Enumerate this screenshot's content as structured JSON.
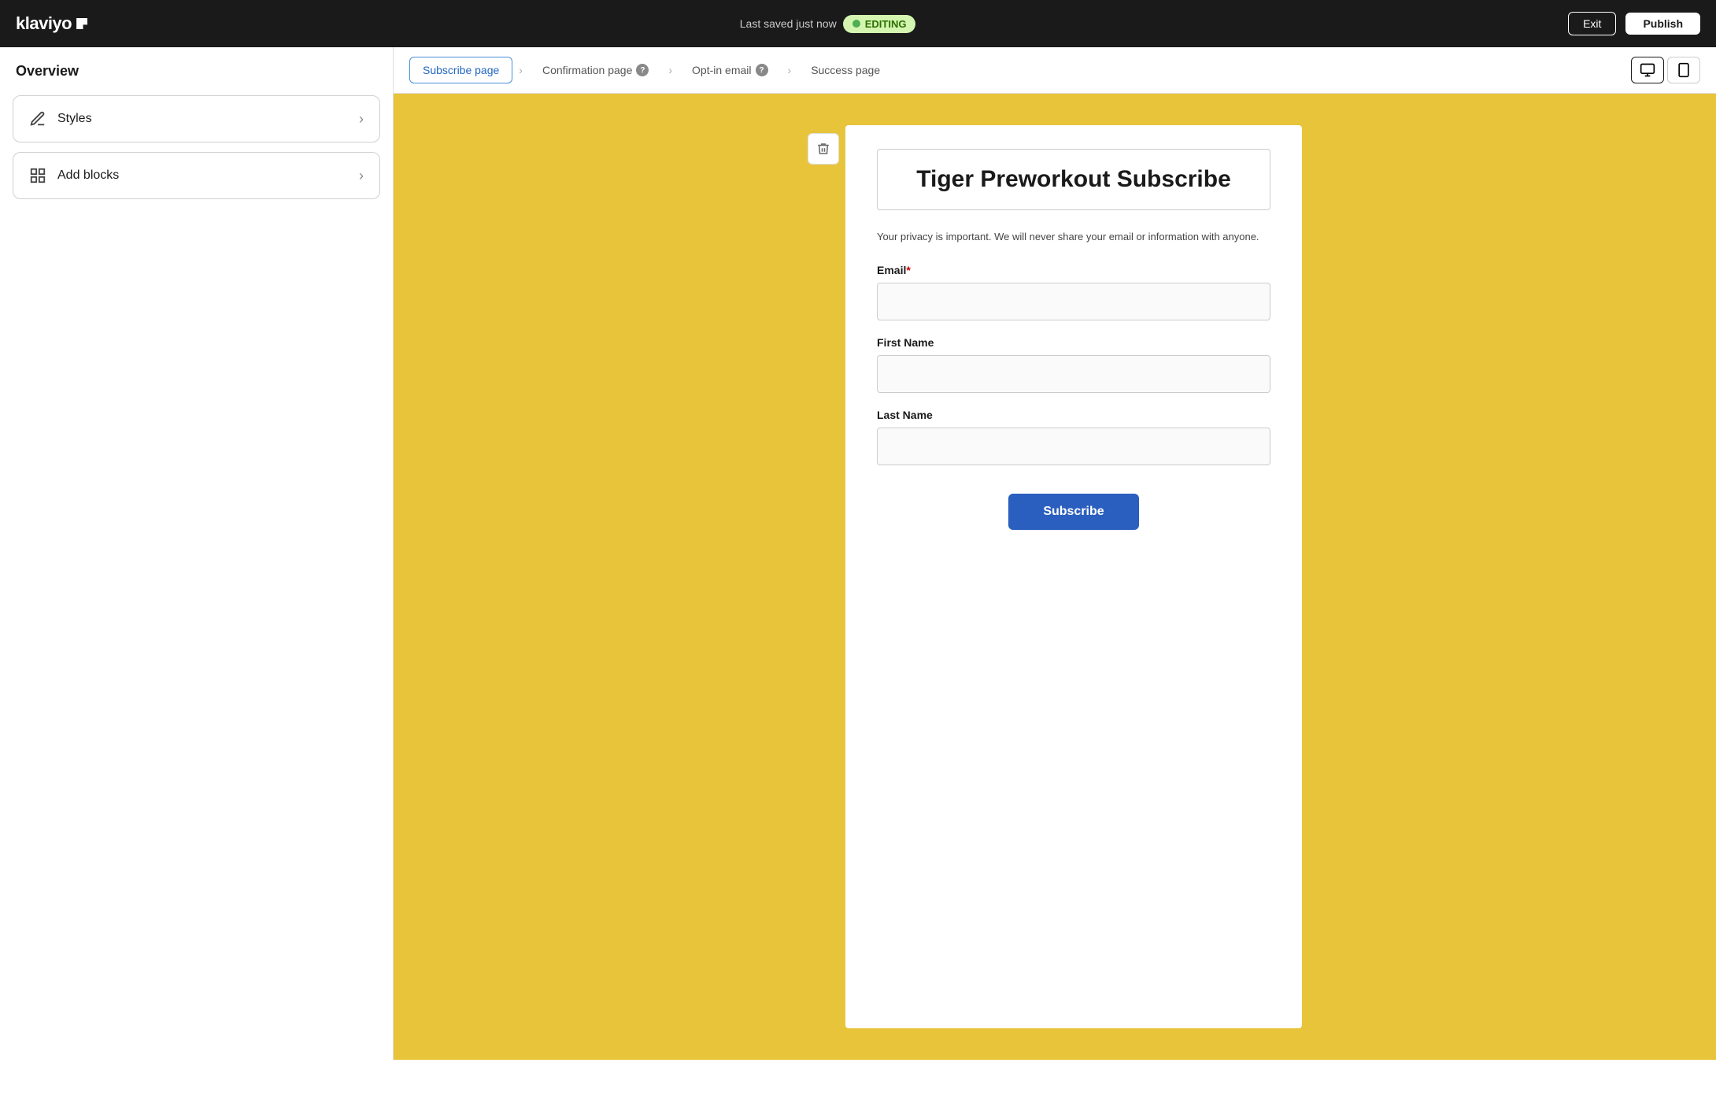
{
  "header": {
    "logo_text": "klaviyo",
    "save_status": "Last saved just now",
    "editing_badge": "EDITING",
    "exit_label": "Exit",
    "publish_label": "Publish"
  },
  "sidebar": {
    "overview_title": "Overview",
    "items": [
      {
        "id": "styles",
        "label": "Styles",
        "icon": "pen-icon"
      },
      {
        "id": "add-blocks",
        "label": "Add blocks",
        "icon": "blocks-icon"
      }
    ]
  },
  "tabs": {
    "items": [
      {
        "id": "subscribe",
        "label": "Subscribe page",
        "active": true
      },
      {
        "id": "confirmation",
        "label": "Confirmation page",
        "active": false,
        "has_info": true
      },
      {
        "id": "optin",
        "label": "Opt-in email",
        "active": false,
        "has_info": true
      },
      {
        "id": "success",
        "label": "Success page",
        "active": false
      }
    ]
  },
  "form": {
    "title": "Tiger Preworkout Subscribe",
    "privacy_text": "Your privacy is important. We will never share your email or information with anyone.",
    "email_label": "Email",
    "email_required": true,
    "first_name_label": "First Name",
    "last_name_label": "Last Name",
    "subscribe_button": "Subscribe"
  },
  "canvas_bg": "#e8c43a"
}
